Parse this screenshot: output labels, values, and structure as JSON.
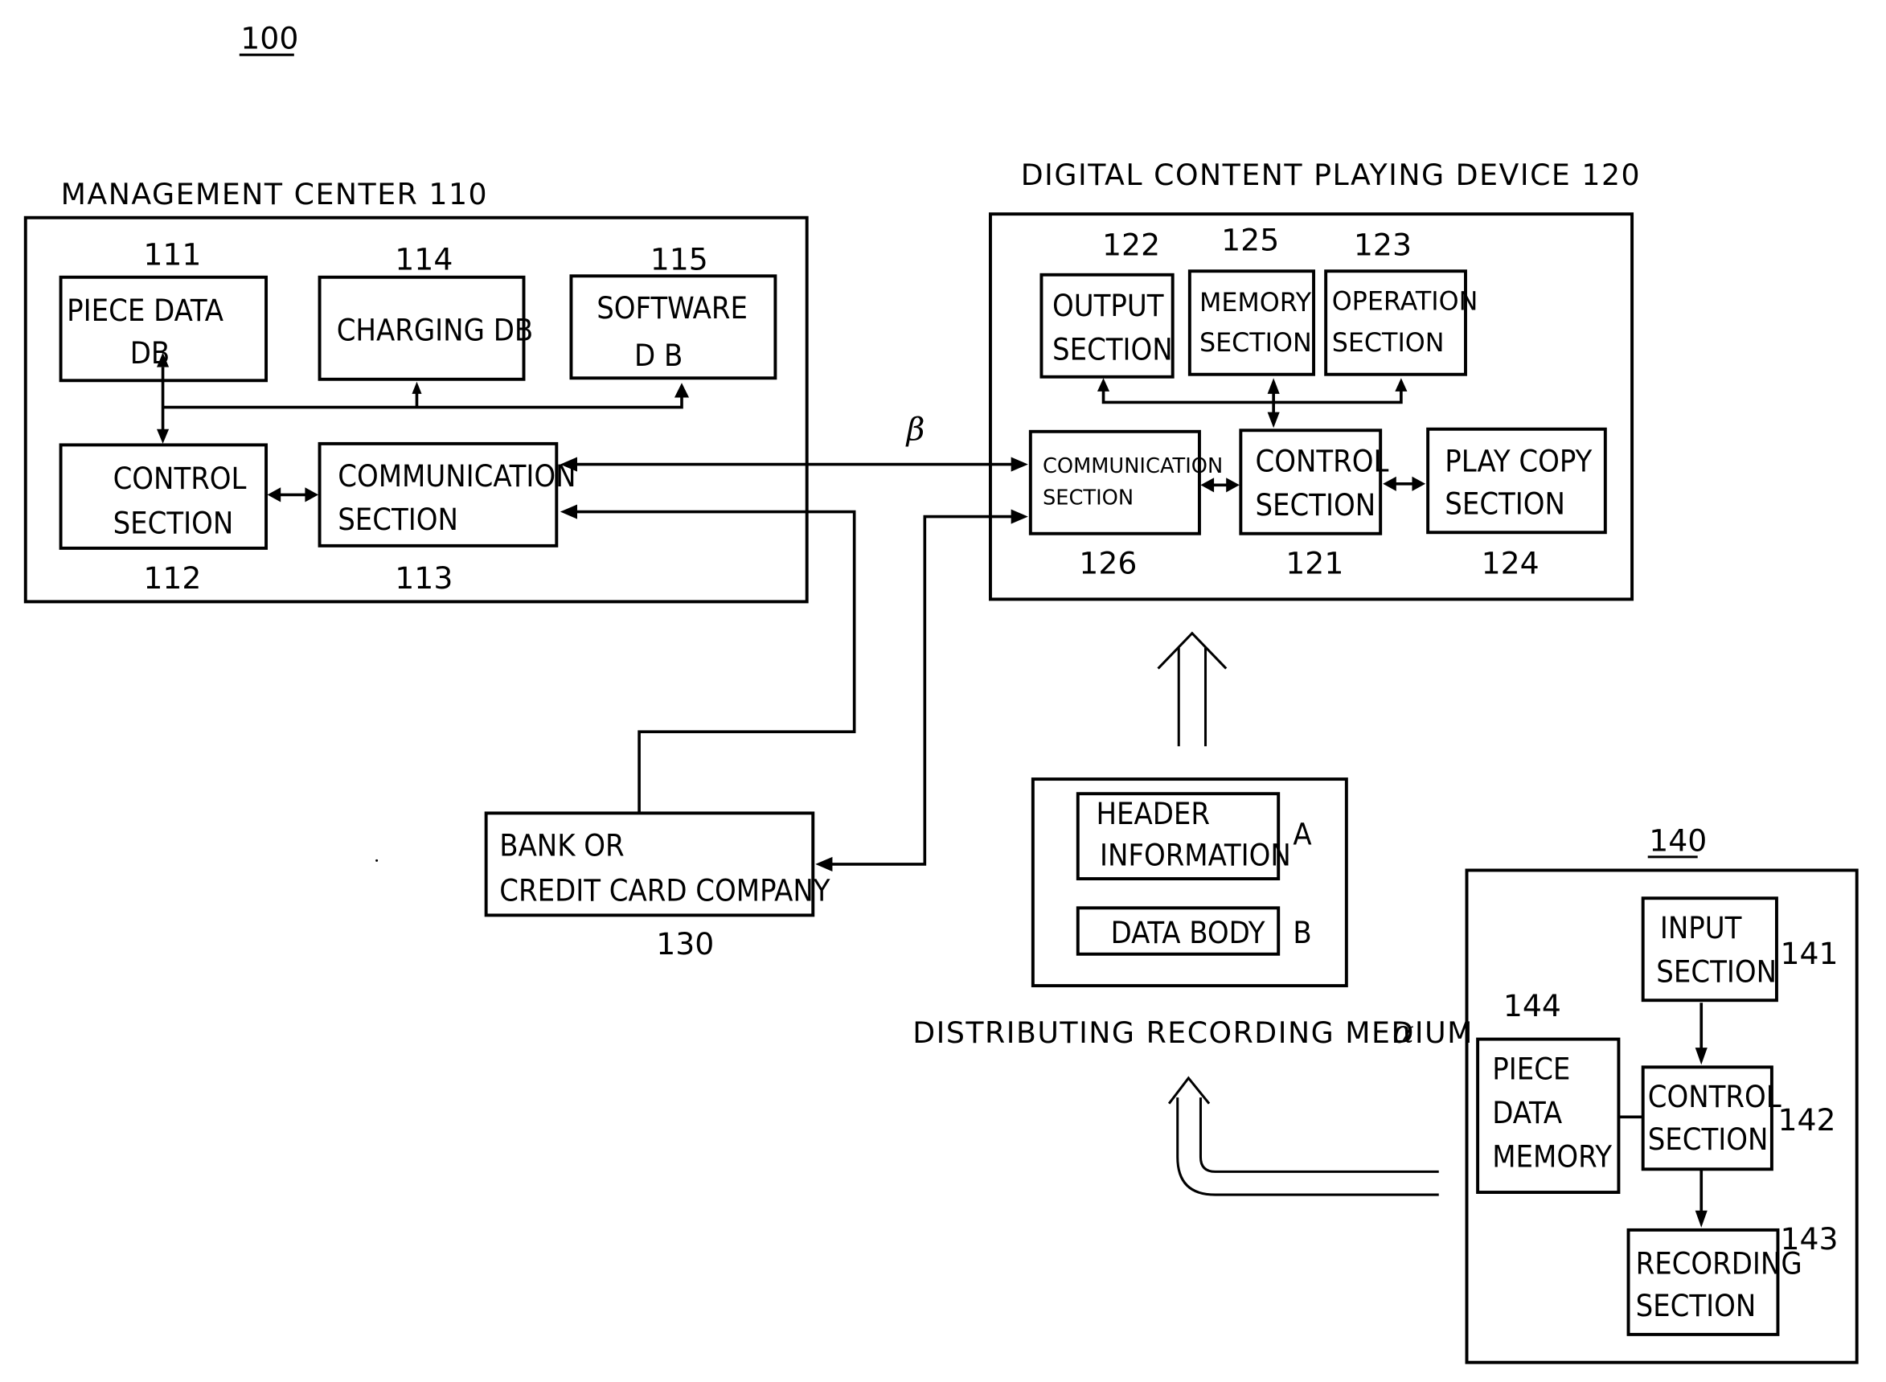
{
  "figure_ref": "100",
  "management_center": {
    "title": "MANAGEMENT CENTER 110",
    "piece_data_db": {
      "ref": "111",
      "line1": "PIECE DATA",
      "line2": "DB"
    },
    "charging_db": {
      "ref": "114",
      "line1": "CHARGING DB"
    },
    "software_db": {
      "ref": "115",
      "line1": "SOFTWARE",
      "line2": "D B"
    },
    "control_section": {
      "ref": "112",
      "line1": "CONTROL",
      "line2": "SECTION"
    },
    "communication_section": {
      "ref": "113",
      "line1": "COMMUNICATION",
      "line2": "SECTION"
    }
  },
  "link_label": "β",
  "playing_device": {
    "title": "DIGITAL CONTENT PLAYING DEVICE 120",
    "output_section": {
      "ref": "122",
      "line1": "OUTPUT",
      "line2": "SECTION"
    },
    "memory_section": {
      "ref": "125",
      "line1": "MEMORY",
      "line2": "SECTION"
    },
    "operation_section": {
      "ref": "123",
      "line1": "OPERATION",
      "line2": "SECTION"
    },
    "communication_section": {
      "ref": "126",
      "line1": "COMMUNICATION",
      "line2": "SECTION"
    },
    "control_section": {
      "ref": "121",
      "line1": "CONTROL",
      "line2": "SECTION"
    },
    "play_copy_section": {
      "ref": "124",
      "line1": "PLAY COPY",
      "line2": "SECTION"
    }
  },
  "bank": {
    "ref": "130",
    "line1": "BANK OR",
    "line2": "CREDIT CARD COMPANY"
  },
  "recording_medium": {
    "caption": "DISTRIBUTING RECORDING MEDIUM",
    "caption_symbol": "α",
    "header": {
      "line1": "HEADER",
      "line2": "INFORMATION",
      "tag": "A"
    },
    "body": {
      "line1": "DATA BODY",
      "tag": "B"
    }
  },
  "recorder": {
    "ref": "140",
    "input_section": {
      "ref": "141",
      "line1": "INPUT",
      "line2": "SECTION"
    },
    "control_section": {
      "ref": "142",
      "line1": "CONTROL",
      "line2": "SECTION"
    },
    "recording_section": {
      "ref": "143",
      "line1": "RECORDING",
      "line2": "SECTION"
    },
    "piece_data_memory": {
      "ref": "144",
      "line1": "PIECE",
      "line2": "DATA",
      "line3": "MEMORY"
    }
  }
}
